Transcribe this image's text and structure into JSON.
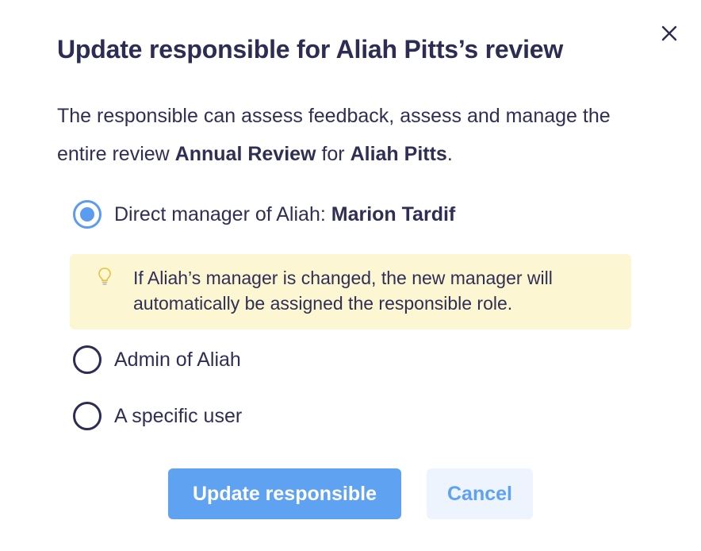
{
  "dialog": {
    "title": "Update responsible for Aliah Pitts’s review",
    "description": {
      "part1": "The responsible can assess feedback, assess and manage the entire review ",
      "review_name": "Annual Review",
      "part2": " for ",
      "person": "Aliah Pitts",
      "part3": "."
    },
    "options": [
      {
        "label": "Direct manager of Aliah: ",
        "value": "Marion Tardif",
        "selected": true
      },
      {
        "label": "Admin of Aliah",
        "selected": false
      },
      {
        "label": "A specific user",
        "selected": false
      }
    ],
    "hint": {
      "icon": "lightbulb-icon",
      "text": "If Aliah’s manager is changed, the new manager will automatically be assigned the responsible role."
    },
    "buttons": {
      "primary": "Update responsible",
      "secondary": "Cancel"
    },
    "close_icon": "close-icon"
  },
  "colors": {
    "text": "#2c2c54",
    "accent": "#5b9cf0",
    "primary_button": "#5fa2f2",
    "secondary_button_bg": "#edf4fd",
    "hint_bg": "#fdf6d3"
  }
}
